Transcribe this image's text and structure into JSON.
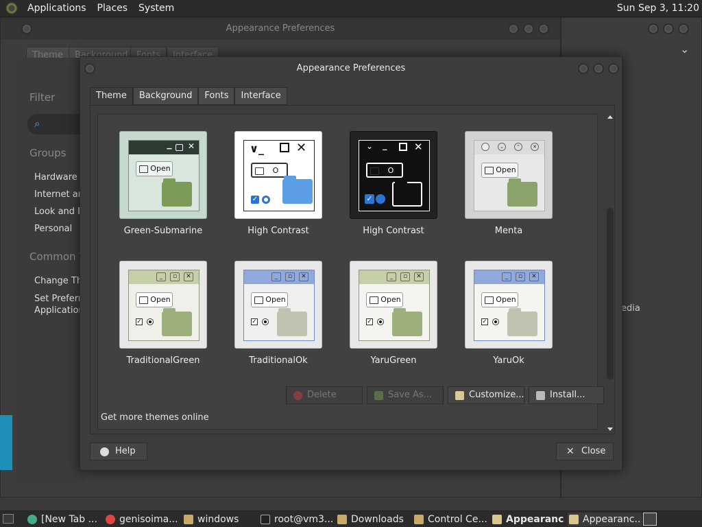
{
  "top_panel": {
    "menus": [
      "Applications",
      "Places",
      "System"
    ],
    "clock": "Sun Sep  3, 11:20"
  },
  "background_window": {
    "title": "Appearance Preferences",
    "tabs": [
      "Theme",
      "Background",
      "Fonts",
      "Interface"
    ]
  },
  "control_center": {
    "filter_label": "Filter",
    "groups_label": "Groups",
    "groups": [
      "Hardware",
      "Internet an",
      "Look and F",
      "Personal"
    ],
    "common_label": "Common T",
    "common_items": [
      "Change Th",
      "Set Preferre\nApplication"
    ],
    "right_text": "edia"
  },
  "dialog": {
    "title": "Appearance Preferences",
    "tabs": [
      "Theme",
      "Background",
      "Fonts",
      "Interface"
    ],
    "active_tab": "Theme",
    "themes": [
      {
        "name": "Green-Submarine",
        "style": "green-sub"
      },
      {
        "name": "High Contrast",
        "style": "hc-light"
      },
      {
        "name": "High Contrast",
        "style": "hc-dark"
      },
      {
        "name": "Menta",
        "style": "menta"
      },
      {
        "name": "TraditionalGreen",
        "style": "trad-green"
      },
      {
        "name": "TraditionalOk",
        "style": "trad-ok"
      },
      {
        "name": "YaruGreen",
        "style": "yaru-green"
      },
      {
        "name": "YaruOk",
        "style": "yaru-ok"
      }
    ],
    "actions": {
      "delete": "Delete",
      "save_as": "Save As...",
      "customize": "Customize...",
      "install": "Install..."
    },
    "more_themes": "Get more themes online",
    "help": "Help",
    "close": "Close"
  },
  "taskbar": {
    "items": [
      "[New Tab ...",
      "genisoima...",
      "windows",
      "root@vm3...",
      "Downloads",
      "Control Ce...",
      "Appearanc...",
      "Appearanc..."
    ],
    "active_index": 6
  },
  "colors": {
    "accent_green": "#8aa36a",
    "window_bg": "#3c3c3c",
    "panel_bg": "#2b2b2b",
    "text": "#e6e6e6"
  }
}
